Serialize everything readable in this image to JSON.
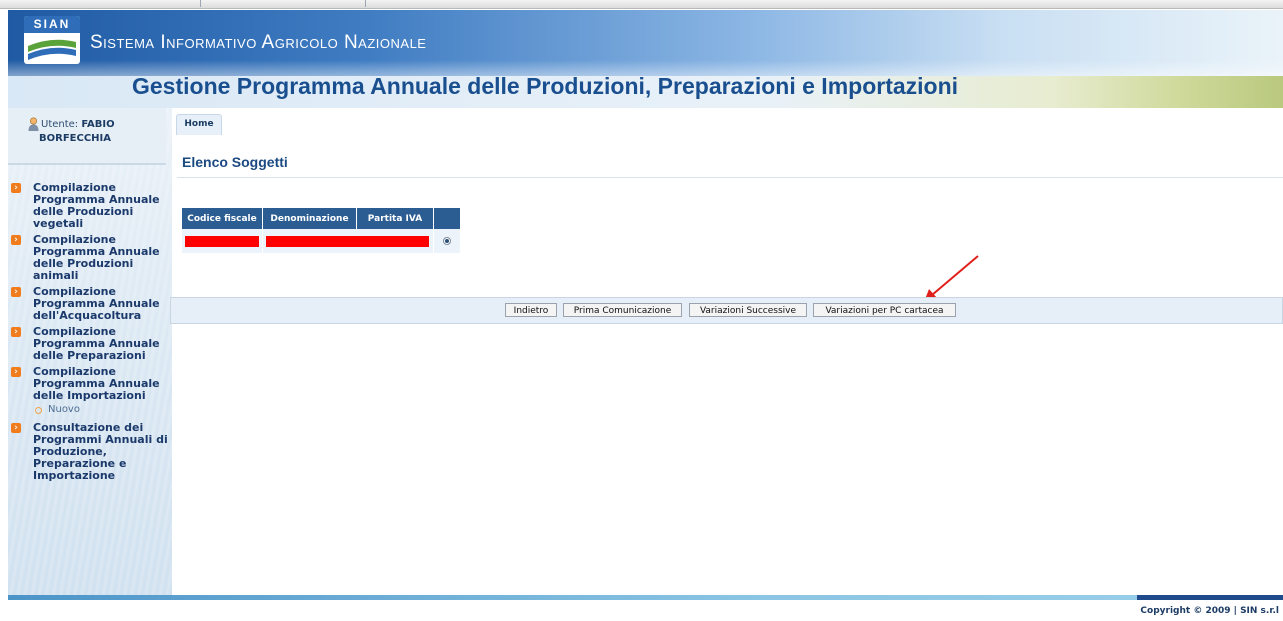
{
  "header": {
    "logo_text": "SIAN",
    "system_title": "Sistema Informativo Agricolo Nazionale",
    "main_title": "Gestione Programma Annuale delle Produzioni, Preparazioni e Importazioni"
  },
  "user": {
    "label": "Utente:",
    "name_first": "FABIO",
    "name_last": "BORFECCHIA"
  },
  "menu": {
    "items": [
      {
        "label": "Compilazione Programma Annuale delle Produzioni vegetali"
      },
      {
        "label": "Compilazione Programma Annuale delle Produzioni animali"
      },
      {
        "label": "Compilazione Programma Annuale dell'Acquacoltura"
      },
      {
        "label": "Compilazione Programma Annuale delle Preparazioni"
      },
      {
        "label": "Compilazione Programma Annuale delle Importazioni"
      },
      {
        "label": "Consultazione dei Programmi Annuali di Produzione, Preparazione e Importazione"
      }
    ],
    "sub_item": "Nuovo"
  },
  "breadcrumb": {
    "home": "Home"
  },
  "content": {
    "section_title": "Elenco Soggetti",
    "table": {
      "columns": [
        "Codice fiscale",
        "Denominazione",
        "Partita IVA"
      ]
    }
  },
  "buttons": {
    "back": "Indietro",
    "first_communication": "Prima Comunicazione",
    "subsequent_changes": "Variazioni Successive",
    "paper_changes": "Variazioni per PC cartacea"
  },
  "footer": {
    "copyright": "Copyright © 2009 | SIN s.r.l"
  },
  "colors": {
    "header_blue": "#1f5aa3",
    "title_blue": "#1a4f8f",
    "table_header": "#2b5d93",
    "menu_icon_orange": "#f07c1e",
    "redaction_red": "#ff0000",
    "annotation_arrow": "#e0201a"
  }
}
